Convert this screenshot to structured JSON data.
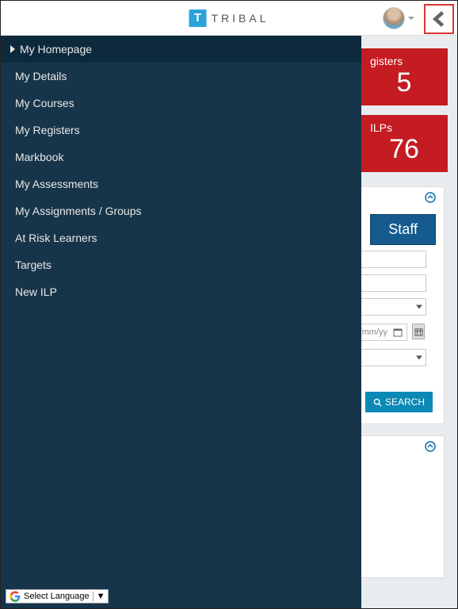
{
  "app": {
    "logo_letter": "T",
    "logo_text": "TRIBAL"
  },
  "sidebar": {
    "items": [
      {
        "label": "My Homepage",
        "active": true
      },
      {
        "label": "My Details",
        "active": false
      },
      {
        "label": "My Courses",
        "active": false
      },
      {
        "label": "My Registers",
        "active": false
      },
      {
        "label": "Markbook",
        "active": false
      },
      {
        "label": "My Assessments",
        "active": false
      },
      {
        "label": "My Assignments / Groups",
        "active": false
      },
      {
        "label": "At Risk Learners",
        "active": false
      },
      {
        "label": "Targets",
        "active": false
      },
      {
        "label": "New ILP",
        "active": false
      }
    ]
  },
  "tiles": {
    "registers_label_fragment": "gisters",
    "registers_value_fragment": "5",
    "ilps_label_fragment": "ILPs",
    "ilps_value_fragment": "76"
  },
  "search": {
    "staff_label": "Staff",
    "date_placeholder": "/mm/yy",
    "search_button": "SEARCH"
  },
  "language": {
    "label": "Select Language",
    "caret": "▼"
  }
}
